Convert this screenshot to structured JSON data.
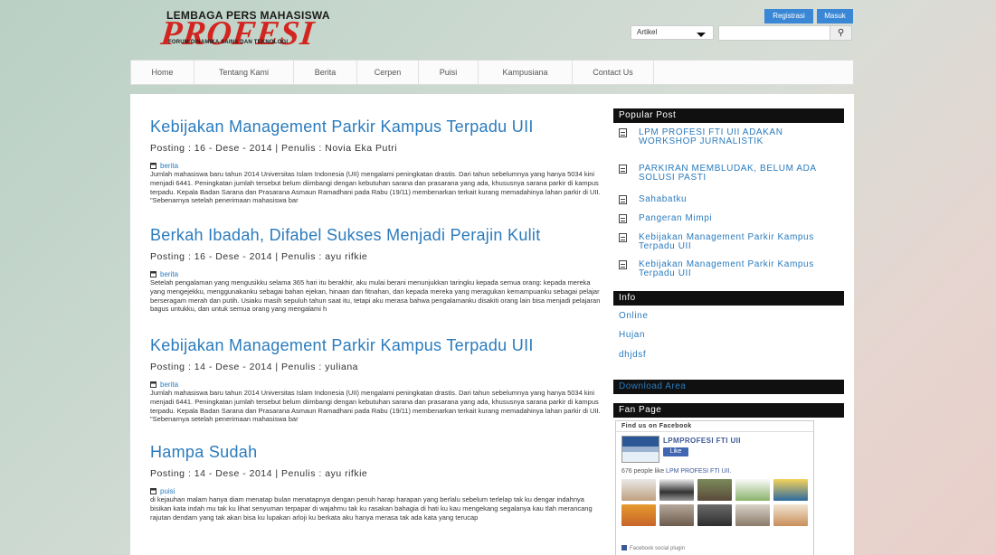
{
  "logo": {
    "top_text": "LEMBAGA PERS MAHASISWA",
    "main_text": "PROFESI",
    "sub_text": "FORUM DINAMIKA SAINS DAN TEKNOLOGI"
  },
  "header": {
    "register_label": "Registrasi",
    "login_label": "Masuk",
    "search_type_selected": "Artikel",
    "search_placeholder": "",
    "search_icon": "search-icon"
  },
  "nav": {
    "items": [
      "Home",
      "Tentang Kami",
      "Berita",
      "Cerpen",
      "Puisi",
      "Kampusiana",
      "Contact Us"
    ]
  },
  "posts": [
    {
      "title": "Kebijakan Management Parkir Kampus Terpadu UII",
      "meta": "Posting : 16 - Dese - 2014 | Penulis : Novia Eka Putri",
      "category": "berita",
      "excerpt": "Jumlah mahasiswa baru tahun 2014 Universitas Islam Indonesia (UII) mengalami peningkatan drastis. Dari tahun sebelumnya yang hanya 5034 kini menjadi 6441. Peningkatan jumlah tersebut belum diimbangi dengan kebutuhan sarana dan prasarana yang ada, khususnya sarana parkir di kampus terpadu. Kepala Badan Sarana dan Prasarana Asmaun Ramadhani pada Rabu (19/11) membenarkan terkait kurang memadahinya lahan parkir di UII. \"Sebenarnya setelah penerimaan mahasiswa bar"
    },
    {
      "title": "Berkah Ibadah, Difabel Sukses Menjadi Perajin Kulit",
      "meta": "Posting : 16 - Dese - 2014 | Penulis : ayu rifkie",
      "category": "berita",
      "excerpt": "Setelah pengalaman yang mengusikku selama 365 hari itu berakhir, aku mulai berani menunjukkan taringku kepada semua orang: kepada mereka yang mengejekku, menggunakanku sebagai bahan ejekan, hinaan dan fitnahan, dan kepada mereka yang meragukan kemampuanku sebagai pelajar berseragam merah dan putih. Usiaku masih sepuluh tahun saat itu, tetapi aku merasa bahwa pengalamanku disakiti orang lain bisa menjadi pelajaran bagus untukku, dan untuk semua orang yang mengalami h"
    },
    {
      "title": "Kebijakan Management Parkir Kampus Terpadu UII",
      "meta": "Posting : 14 - Dese - 2014 | Penulis : yuliana",
      "category": "berita",
      "excerpt": "Jumlah mahasiswa baru tahun 2014 Universitas Islam Indonesia (UII) mengalami peningkatan drastis. Dari tahun sebelumnya yang hanya 5034 kini menjadi 6441. Peningkatan jumlah tersebut belum diimbangi dengan kebutuhan sarana dan prasarana yang ada, khususnya sarana parkir di kampus terpadu. Kepala Badan Sarana dan Prasarana Asmaun Ramadhani pada Rabu (19/11) membenarkan terkait kurang memadahinya lahan parkir di UII. \"Sebenarnya setelah penerimaan mahasiswa bar"
    },
    {
      "title": "Hampa Sudah",
      "meta": "Posting : 14 - Dese - 2014 | Penulis : ayu rifkie",
      "category": "puisi",
      "excerpt": "di kejauhan malam hanya diam menatap bulan menatapnya dengan penuh harap harapan yang berlalu sebelum terlelap tak ku dengar indahnya bisikan kata indah mu tak ku lihat senyuman terpapar di wajahmu tak ku rasakan bahagia di hati ku kau mengekang segalanya kau tlah merancang rajutan dendam yang tak akan bisa ku lupakan arloji ku berkata aku hanya merasa tak ada kata yang terucap"
    }
  ],
  "sidebar": {
    "popular_title": "Popular Post",
    "popular_items": [
      "LPM PROFESI FTI UII ADAKAN WORKSHOP JURNALISTIK",
      "PARKIRAN MEMBLUDAK, BELUM ADA SOLUSI PASTI",
      "Sahabatku",
      "Pangeran Mimpi",
      "Kebijakan Management Parkir Kampus Terpadu UII",
      "Kebijakan Management Parkir Kampus Terpadu UII"
    ],
    "info_title": "Info",
    "info_items": [
      "Online",
      "Hujan",
      "dhjdsf"
    ],
    "download_title": "Download Area",
    "fanpage_title": "Fan Page",
    "fb": {
      "find_text": "Find us on Facebook",
      "page_name": "LPMPROFESI FTI UII",
      "like_label": "Like",
      "count_prefix": "676 people like ",
      "count_link": "LPM PROFESI FTI UII.",
      "plugin_text": "Facebook social plugin"
    }
  },
  "colors": {
    "accent": "#2a7bbd",
    "brand_red": "#d3251f",
    "header_black": "#101010",
    "button_blue": "#3a87d6"
  }
}
